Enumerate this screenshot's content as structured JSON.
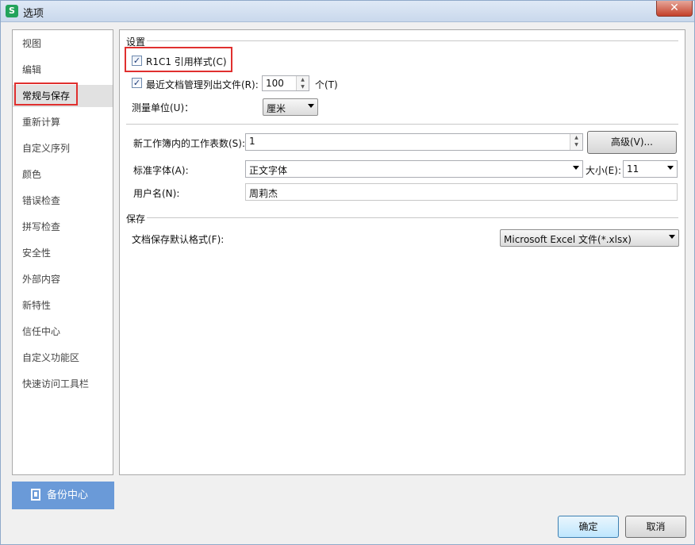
{
  "window": {
    "title": "选项",
    "app_icon": "S",
    "close_glyph": "✕"
  },
  "sidebar": {
    "items": [
      {
        "label": "视图"
      },
      {
        "label": "编辑"
      },
      {
        "label": "常规与保存"
      },
      {
        "label": "重新计算"
      },
      {
        "label": "自定义序列"
      },
      {
        "label": "颜色"
      },
      {
        "label": "错误检查"
      },
      {
        "label": "拼写检查"
      },
      {
        "label": "安全性"
      },
      {
        "label": "外部内容"
      },
      {
        "label": "新特性"
      },
      {
        "label": "信任中心"
      },
      {
        "label": "自定义功能区"
      },
      {
        "label": "快速访问工具栏"
      }
    ],
    "active_index": 2,
    "backup_label": "备份中心"
  },
  "settings": {
    "section_title": "设置",
    "r1c1_label": "R1C1 引用样式(C)",
    "r1c1_checked": true,
    "recent_label": "最近文档管理列出文件(R):",
    "recent_checked": true,
    "recent_value": "100",
    "recent_unit": "个(T)",
    "unit_label": "测量单位(U)：",
    "unit_value": "厘米",
    "sheets_label": "新工作簿内的工作表数(S):",
    "sheets_value": "1",
    "advanced_label": "高级(V)...",
    "font_label": "标准字体(A):",
    "font_value": "正文字体",
    "size_label": "大小(E):",
    "size_value": "11",
    "username_label": "用户名(N):",
    "username_value": "周莉杰"
  },
  "save": {
    "section_title": "保存",
    "format_label": "文档保存默认格式(F):",
    "format_value": "Microsoft Excel 文件(*.xlsx)"
  },
  "footer": {
    "ok_label": "确定",
    "cancel_label": "取消"
  },
  "colors": {
    "highlight": "#e0302f",
    "backup_bg": "#6a9ad8",
    "active_item_bg": "#e1e1e1"
  }
}
